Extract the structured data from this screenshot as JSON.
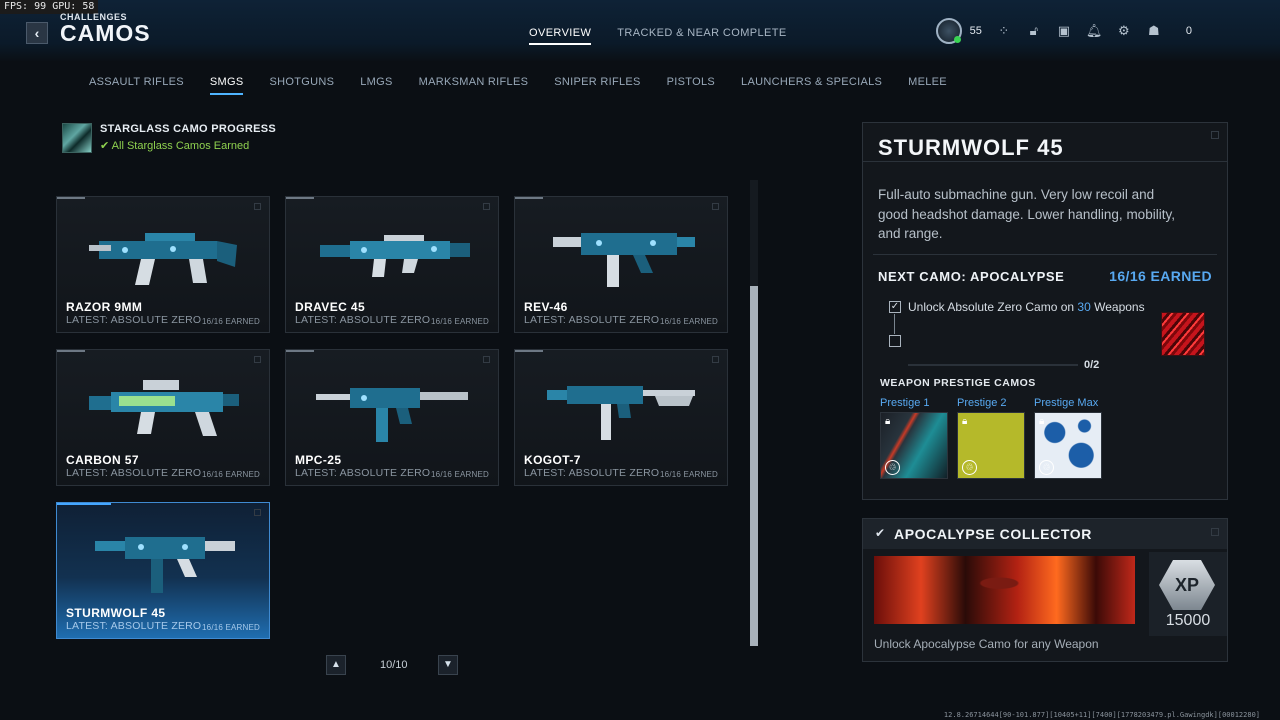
{
  "perf": {
    "fps_label": "FPS:",
    "fps": "99",
    "gpu_label": "GPU:",
    "gpu": "58"
  },
  "header": {
    "section": "CHALLENGES",
    "title": "CAMOS",
    "tabs": [
      {
        "label": "OVERVIEW",
        "active": true
      },
      {
        "label": "TRACKED & NEAR COMPLETE",
        "active": false
      }
    ],
    "level": "55",
    "currency": "0",
    "icons": [
      "level-badge",
      "social-icon",
      "lock-icon",
      "store-icon",
      "bell-icon",
      "settings-icon",
      "friends-icon"
    ]
  },
  "categories": [
    {
      "label": "ASSAULT RIFLES",
      "active": false
    },
    {
      "label": "SMGS",
      "active": true
    },
    {
      "label": "SHOTGUNS",
      "active": false
    },
    {
      "label": "LMGS",
      "active": false
    },
    {
      "label": "MARKSMAN RIFLES",
      "active": false
    },
    {
      "label": "SNIPER RIFLES",
      "active": false
    },
    {
      "label": "PISTOLS",
      "active": false
    },
    {
      "label": "LAUNCHERS & SPECIALS",
      "active": false
    },
    {
      "label": "MELEE",
      "active": false
    }
  ],
  "starglass": {
    "title": "STARGLASS CAMO PROGRESS",
    "status": "All Starglass Camos Earned"
  },
  "weapons": [
    {
      "name": "RAZOR 9MM",
      "latest": "LATEST: ABSOLUTE ZERO",
      "earned": "16/16 EARNED",
      "selected": false
    },
    {
      "name": "DRAVEC 45",
      "latest": "LATEST: ABSOLUTE ZERO",
      "earned": "16/16 EARNED",
      "selected": false
    },
    {
      "name": "REV-46",
      "latest": "LATEST: ABSOLUTE ZERO",
      "earned": "16/16 EARNED",
      "selected": false
    },
    {
      "name": "CARBON 57",
      "latest": "LATEST: ABSOLUTE ZERO",
      "earned": "16/16 EARNED",
      "selected": false
    },
    {
      "name": "MPC-25",
      "latest": "LATEST: ABSOLUTE ZERO",
      "earned": "16/16 EARNED",
      "selected": false
    },
    {
      "name": "KOGOT-7",
      "latest": "LATEST: ABSOLUTE ZERO",
      "earned": "16/16 EARNED",
      "selected": false
    },
    {
      "name": "STURMWOLF 45",
      "latest": "LATEST: ABSOLUTE ZERO",
      "earned": "16/16 EARNED",
      "selected": true
    }
  ],
  "pager": {
    "text": "10/10"
  },
  "detail": {
    "title": "STURMWOLF 45",
    "description": "Full-auto submachine gun. Very low recoil and good headshot damage. Lower handling, mobility, and range.",
    "next_camo": "NEXT CAMO: APOCALYPSE",
    "next_earned": "16/16 EARNED",
    "challenge_prefix": "Unlock Absolute Zero Camo on ",
    "challenge_count": "30",
    "challenge_suffix": " Weapons",
    "progress": "0/2",
    "prestige_header": "WEAPON PRESTIGE CAMOS",
    "prestige": [
      {
        "label": "Prestige 1"
      },
      {
        "label": "Prestige 2"
      },
      {
        "label": "Prestige Max"
      }
    ]
  },
  "collector": {
    "title": "APOCALYPSE COLLECTOR",
    "xp_badge": "XP",
    "xp_value": "15000",
    "description": "Unlock Apocalypse Camo for any Weapon"
  },
  "build": "12.8.26714644[90-101.877][10405+11][7400][1778203479.pl.Gawingdk][00012280]"
}
